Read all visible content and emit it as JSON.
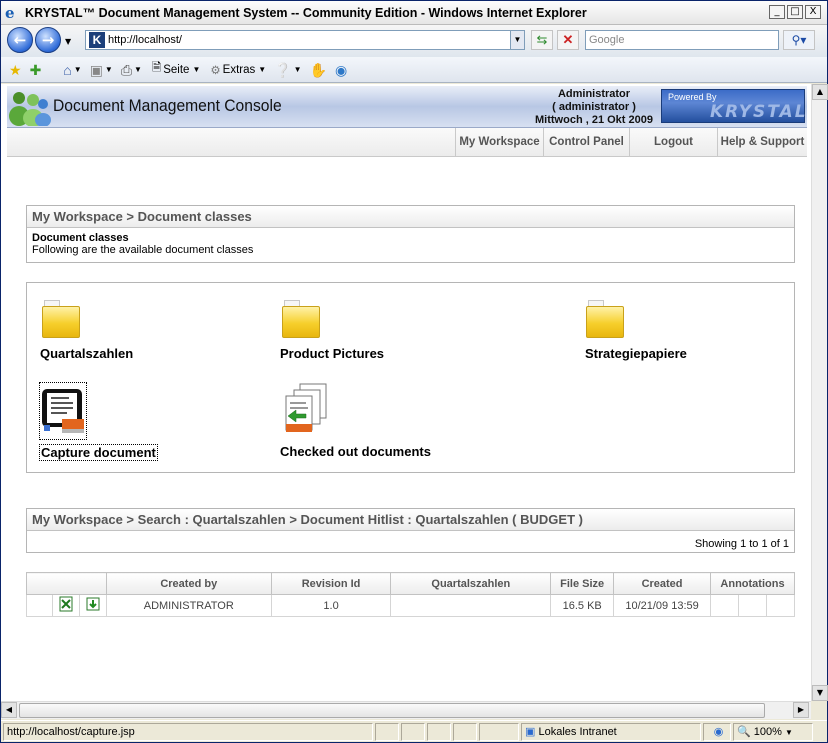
{
  "window": {
    "title": "KRYSTAL™ Document Management System -- Community Edition - Windows Internet Explorer",
    "controls": {
      "minimize": "_",
      "maximize": "□",
      "close": "X"
    }
  },
  "browser": {
    "address": "http://localhost/",
    "search_placeholder": "Google",
    "toolbar": {
      "page_label": "Seite",
      "tools_label": "Extras"
    }
  },
  "app": {
    "title": "Document Management Console",
    "user": {
      "name": "Administrator",
      "login": "( administrator )",
      "date": "Mittwoch , 21 Okt 2009"
    },
    "powered_by": {
      "label": "Powered By",
      "brand": "KRYSTAL"
    },
    "menu": [
      {
        "label": "My Workspace"
      },
      {
        "label": "Control Panel"
      },
      {
        "label": "Logout"
      },
      {
        "label": "Help & Support"
      }
    ]
  },
  "doc_classes_panel": {
    "breadcrumb": "My Workspace > Document classes",
    "heading": "Document classes",
    "description": "Following are the available document classes"
  },
  "classes": [
    {
      "label": "Quartalszahlen"
    },
    {
      "label": "Product Pictures"
    },
    {
      "label": "Strategiepapiere"
    },
    {
      "label": "Capture document"
    },
    {
      "label": "Checked out documents"
    }
  ],
  "hitlist": {
    "breadcrumb": "My Workspace > Search : Quartalszahlen > Document Hitlist : Quartalszahlen ( BUDGET )",
    "showing": "Showing 1 to 1 of 1",
    "columns": [
      "Created by",
      "Revision Id",
      "Quartalszahlen",
      "File Size",
      "Created",
      "Annotations"
    ],
    "rows": [
      {
        "created_by": "ADMINISTRATOR",
        "revision_id": "1.0",
        "quartalszahlen": "",
        "file_size": "16.5 KB",
        "created": "10/21/09 13:59"
      }
    ]
  },
  "status": {
    "url": "http://localhost/capture.jsp",
    "zone": "Lokales Intranet",
    "zoom": "100%"
  }
}
